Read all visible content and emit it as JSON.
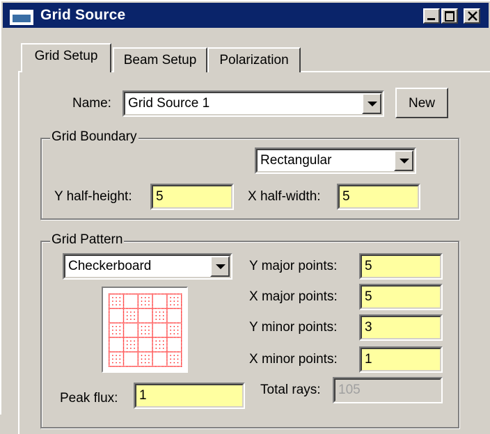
{
  "window": {
    "title": "Grid Source"
  },
  "tabs": [
    {
      "label": "Grid Setup",
      "active": true
    },
    {
      "label": "Beam Setup",
      "active": false
    },
    {
      "label": "Polarization",
      "active": false
    }
  ],
  "name_row": {
    "label": "Name:",
    "value": "Grid Source 1",
    "new_label": "New"
  },
  "boundary": {
    "title": "Grid Boundary",
    "shape": "Rectangular",
    "y_half_height": {
      "label": "Y half-height:",
      "value": "5"
    },
    "x_half_width": {
      "label": "X half-width:",
      "value": "5"
    }
  },
  "pattern": {
    "title": "Grid Pattern",
    "type": "Checkerboard",
    "y_major": {
      "label": "Y major points:",
      "value": "5"
    },
    "x_major": {
      "label": "X major points:",
      "value": "5"
    },
    "y_minor": {
      "label": "Y minor points:",
      "value": "3"
    },
    "x_minor": {
      "label": "X minor points:",
      "value": "1"
    },
    "peak_flux": {
      "label": "Peak flux:",
      "value": "1"
    },
    "total_rays": {
      "label": "Total rays:",
      "value": "105"
    }
  },
  "colors": {
    "titlebar": "#0a246a",
    "field_highlight": "#ffffa0",
    "preview_dots": "#ff0000"
  }
}
